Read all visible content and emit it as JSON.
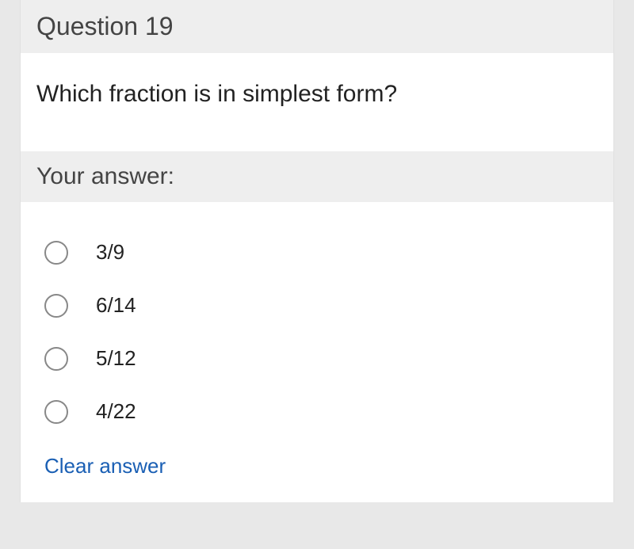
{
  "question": {
    "header": "Question 19",
    "text": "Which fraction is in simplest form?"
  },
  "answer": {
    "header": "Your answer:",
    "options": [
      "3/9",
      "6/14",
      "5/12",
      "4/22"
    ],
    "clear_label": "Clear answer"
  }
}
